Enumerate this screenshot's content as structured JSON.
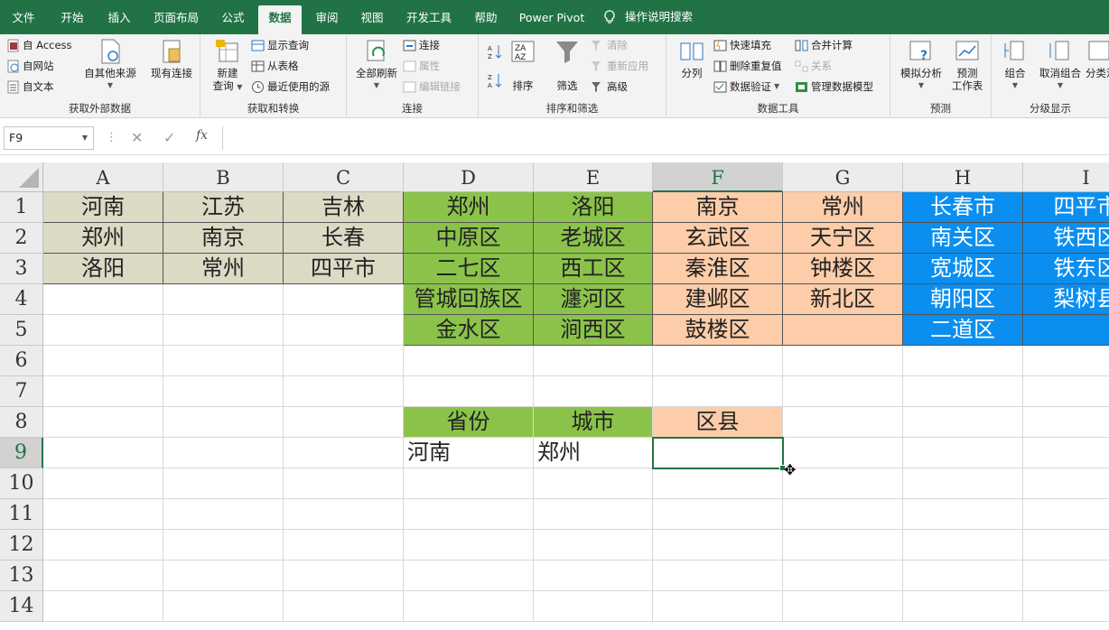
{
  "menubar": {
    "tabs": [
      "文件",
      "开始",
      "插入",
      "页面布局",
      "公式",
      "数据",
      "审阅",
      "视图",
      "开发工具",
      "帮助",
      "Power Pivot"
    ],
    "active_tab": "数据",
    "search_label": "操作说明搜索"
  },
  "ribbon": {
    "get_external": {
      "label": "获取外部数据",
      "access": "自 Access",
      "web": "自网站",
      "text": "自文本",
      "other": "自其他来源",
      "existing": "现有连接"
    },
    "transform": {
      "label": "获取和转换",
      "new_query_1": "新建",
      "new_query_2": "查询",
      "show_queries": "显示查询",
      "from_table": "从表格",
      "recent_sources": "最近使用的源"
    },
    "connections": {
      "label": "连接",
      "refresh_all": "全部刷新",
      "connections": "连接",
      "properties": "属性",
      "edit_links": "编辑链接"
    },
    "sort_filter": {
      "label": "排序和筛选",
      "sort": "排序",
      "filter": "筛选",
      "clear": "清除",
      "reapply": "重新应用",
      "advanced": "高级"
    },
    "data_tools": {
      "label": "数据工具",
      "split": "分列",
      "flash_fill": "快速填充",
      "remove_dup": "删除重复值",
      "validation": "数据验证",
      "consolidate": "合并计算",
      "relations": "关系",
      "manage_model": "管理数据模型"
    },
    "forecast": {
      "label": "预测",
      "what_if": "模拟分析",
      "forecast_sheet_1": "预测",
      "forecast_sheet_2": "工作表"
    },
    "outline": {
      "label": "分级显示",
      "group": "组合",
      "ungroup": "取消组合",
      "subtotal": "分类汇"
    }
  },
  "formula_bar": {
    "name_box": "F9",
    "fx": "fx",
    "value": ""
  },
  "sheet": {
    "columns": [
      "A",
      "B",
      "C",
      "D",
      "E",
      "F",
      "G",
      "H",
      "I"
    ],
    "selected_column": "F",
    "rows": [
      "1",
      "2",
      "3",
      "4",
      "5",
      "6",
      "7",
      "8",
      "9",
      "10",
      "11",
      "12",
      "13",
      "14"
    ],
    "selected_row": "9",
    "colors": {
      "beige": "#dcd9c5",
      "green": "#8bc34a",
      "peach": "#fdcda9",
      "blue": "#0a8ef0",
      "accent": "#217346"
    },
    "cells": {
      "A1": "河南",
      "B1": "江苏",
      "C1": "吉林",
      "A2": "郑州",
      "B2": "南京",
      "C2": "长春",
      "A3": "洛阳",
      "B3": "常州",
      "C3": "四平市",
      "D1": "郑州",
      "E1": "洛阳",
      "F1": "南京",
      "G1": "常州",
      "H1": "长春市",
      "I1": "四平市",
      "D2": "中原区",
      "E2": "老城区",
      "F2": "玄武区",
      "G2": "天宁区",
      "H2": "南关区",
      "I2": "铁西区",
      "D3": "二七区",
      "E3": "西工区",
      "F3": "秦淮区",
      "G3": "钟楼区",
      "H3": "宽城区",
      "I3": "铁东区",
      "D4": "管城回族区",
      "E4": "瀍河区",
      "F4": "建邺区",
      "G4": "新北区",
      "H4": "朝阳区",
      "I4": "梨树县",
      "D5": "金水区",
      "E5": "涧西区",
      "F5": "鼓楼区",
      "G5": "",
      "H5": "二道区",
      "I5": "",
      "D8": "省份",
      "E8": "城市",
      "F8": "区县",
      "D9": "河南",
      "E9": "郑州",
      "F9": ""
    }
  }
}
